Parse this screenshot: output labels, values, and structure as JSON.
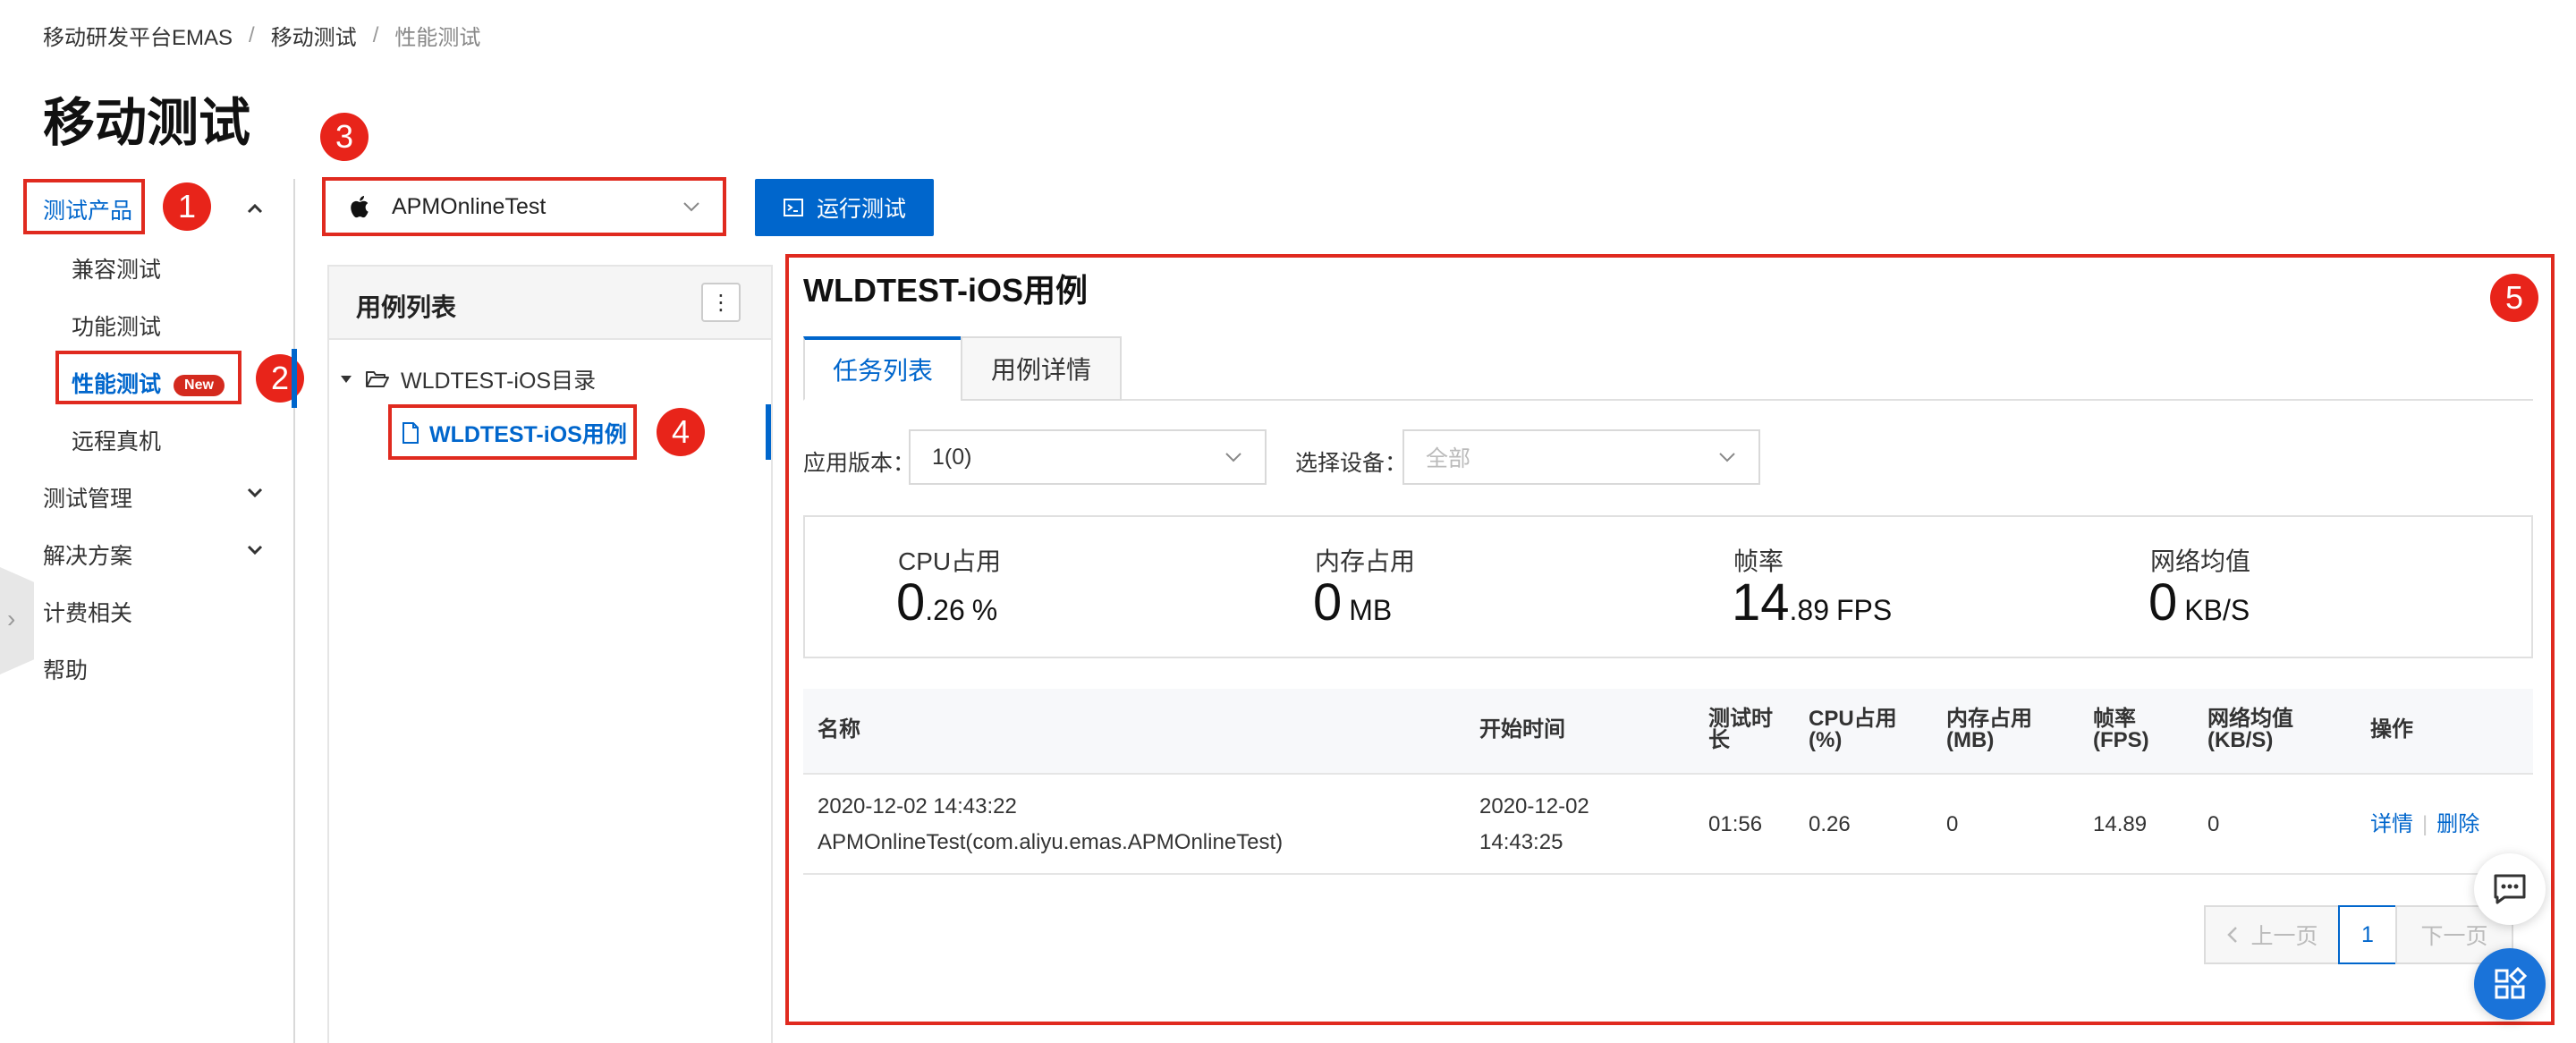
{
  "breadcrumb": {
    "items": [
      "移动研发平台EMAS",
      "移动测试"
    ],
    "current": "性能测试",
    "separator": "/"
  },
  "page_title": "移动测试",
  "sidebar": {
    "group_products": "测试产品",
    "items": [
      {
        "label": "兼容测试"
      },
      {
        "label": "功能测试"
      },
      {
        "label": "性能测试",
        "badge": "New",
        "active": true
      },
      {
        "label": "远程真机"
      }
    ],
    "groups": [
      "测试管理",
      "解决方案",
      "计费相关",
      "帮助"
    ]
  },
  "annotations": [
    "1",
    "2",
    "3",
    "4",
    "5"
  ],
  "app_select": {
    "value": "APMOnlineTest"
  },
  "run_button": {
    "label": "运行测试"
  },
  "case_list": {
    "title": "用例列表",
    "more": "⋮",
    "folder": "WLDTEST-iOS目录",
    "case": "WLDTEST-iOS用例"
  },
  "detail": {
    "title": "WLDTEST-iOS用例",
    "tabs": [
      "任务列表",
      "用例详情"
    ],
    "filters": {
      "version_label": "应用版本：",
      "version_value": "1(0)",
      "device_label": "选择设备：",
      "device_placeholder": "全部"
    },
    "metrics": [
      {
        "label": "CPU占用",
        "int": "0",
        "dec": ".26",
        "unit": "%"
      },
      {
        "label": "内存占用",
        "int": "0",
        "dec": "",
        "unit": "MB"
      },
      {
        "label": "帧率",
        "int": "14",
        "dec": ".89",
        "unit": "FPS"
      },
      {
        "label": "网络均值",
        "int": "0",
        "dec": "",
        "unit": "KB/S"
      }
    ],
    "table": {
      "headers": {
        "name": "名称",
        "start": "开始时间",
        "duration_1": "测试时",
        "duration_2": "长",
        "cpu_1": "CPU占用",
        "cpu_2": "(%)",
        "mem_1": "内存占用",
        "mem_2": "(MB)",
        "fps_1": "帧率",
        "fps_2": "(FPS)",
        "net_1": "网络均值",
        "net_2": "(KB/S)",
        "op": "操作"
      },
      "rows": [
        {
          "name_1": "2020-12-02 14:43:22",
          "name_2": "APMOnlineTest(com.aliyu.emas.APMOnlineTest)",
          "start_1": "2020-12-02",
          "start_2": "14:43:25",
          "duration": "01:56",
          "cpu": "0.26",
          "mem": "0",
          "fps": "14.89",
          "net": "0",
          "op_detail": "详情",
          "op_delete": "删除"
        }
      ]
    },
    "pagination": {
      "prev": "上一页",
      "current": "1",
      "next": "下一页"
    }
  },
  "colors": {
    "accent": "#0066cc",
    "annotation": "#e02a1f",
    "badge": "#d42a1e"
  }
}
